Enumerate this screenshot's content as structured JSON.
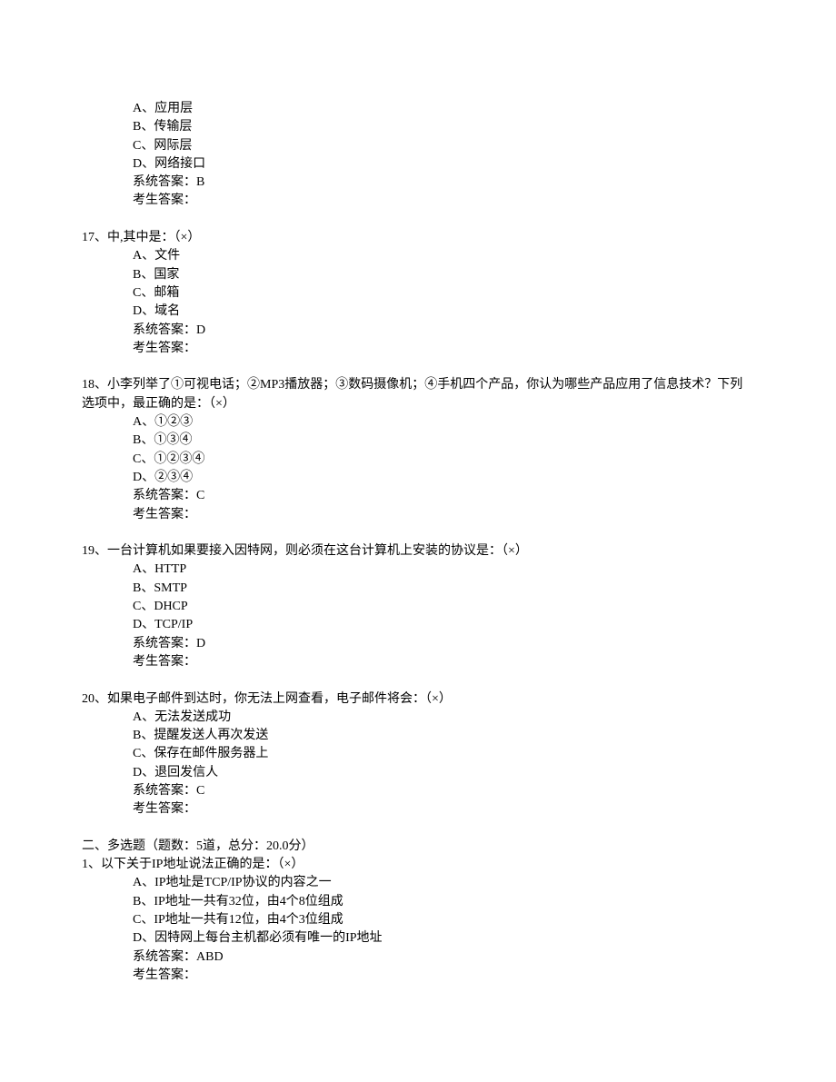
{
  "q16": {
    "optA": "A、应用层",
    "optB": "B、传输层",
    "optC": "C、网际层",
    "optD": "D、网络接口",
    "sysAns": "系统答案：B",
    "stuAns": "考生答案："
  },
  "q17": {
    "stem": "17、中,其中是：（×）",
    "optA": "A、文件",
    "optB": "B、国家",
    "optC": "C、邮箱",
    "optD": "D、域名",
    "sysAns": "系统答案：D",
    "stuAns": "考生答案："
  },
  "q18": {
    "stem": "18、小李列举了①可视电话；②MP3播放器；③数码摄像机；④手机四个产品，你认为哪些产品应用了信息技术？下列选项中，最正确的是：（×）",
    "optA": "A、①②③",
    "optB": "B、①③④",
    "optC": "C、①②③④",
    "optD": "D、②③④",
    "sysAns": "系统答案：C",
    "stuAns": "考生答案："
  },
  "q19": {
    "stem": "19、一台计算机如果要接入因特网，则必须在这台计算机上安装的协议是：（×）",
    "optA": "A、HTTP",
    "optB": "B、SMTP",
    "optC": "C、DHCP",
    "optD": "D、TCP/IP",
    "sysAns": "系统答案：D",
    "stuAns": "考生答案："
  },
  "q20": {
    "stem": "20、如果电子邮件到达时，你无法上网查看，电子邮件将会：（×）",
    "optA": "A、无法发送成功",
    "optB": "B、提醒发送人再次发送",
    "optC": "C、保存在邮件服务器上",
    "optD": "D、退回发信人",
    "sysAns": "系统答案：C",
    "stuAns": "考生答案："
  },
  "section2": {
    "header": "二、多选题（题数：5道，总分：20.0分）"
  },
  "m1": {
    "stem": "1、以下关于IP地址说法正确的是：（×）",
    "optA": "A、IP地址是TCP/IP协议的内容之一",
    "optB": "B、IP地址一共有32位，由4个8位组成",
    "optC": "C、IP地址一共有12位，由4个3位组成",
    "optD": "D、因特网上每台主机都必须有唯一的IP地址",
    "sysAns": "系统答案：ABD",
    "stuAns": "考生答案："
  }
}
